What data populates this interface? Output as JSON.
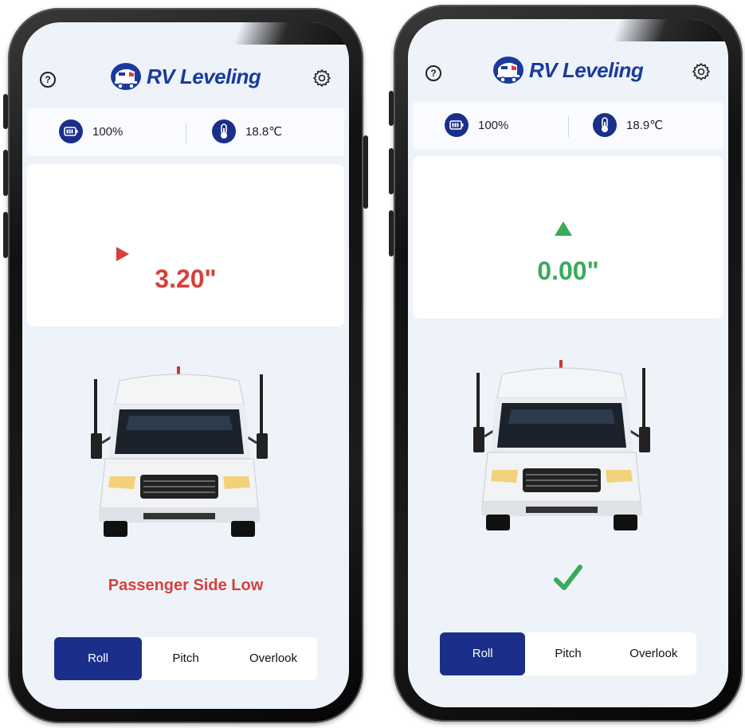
{
  "app": {
    "title": "RV Leveling"
  },
  "phones": [
    {
      "battery": "100%",
      "temperature": "18.8℃",
      "gauge_value": "3.20\"",
      "gauge_value_number": 3.2,
      "gauge_state": "off-level",
      "status": "Passenger Side Low",
      "tabs": [
        "Roll",
        "Pitch",
        "Overlook"
      ],
      "active_tab": "Roll"
    },
    {
      "battery": "100%",
      "temperature": "18.9℃",
      "gauge_value": "0.00\"",
      "gauge_value_number": 0.0,
      "gauge_state": "level",
      "status_icon": "check-icon",
      "tabs": [
        "Roll",
        "Pitch",
        "Overlook"
      ],
      "active_tab": "Roll"
    }
  ],
  "colors": {
    "brand": "#1a3a9c",
    "tab_active": "#1b2f8a",
    "off_level": "#d6403b",
    "level": "#3aaa5c",
    "warn": "#e8a93a"
  },
  "icons": {
    "help": "question-circle-icon",
    "settings": "gear-icon",
    "battery": "battery-icon",
    "temperature": "thermometer-icon",
    "logo": "rv-logo-icon"
  }
}
